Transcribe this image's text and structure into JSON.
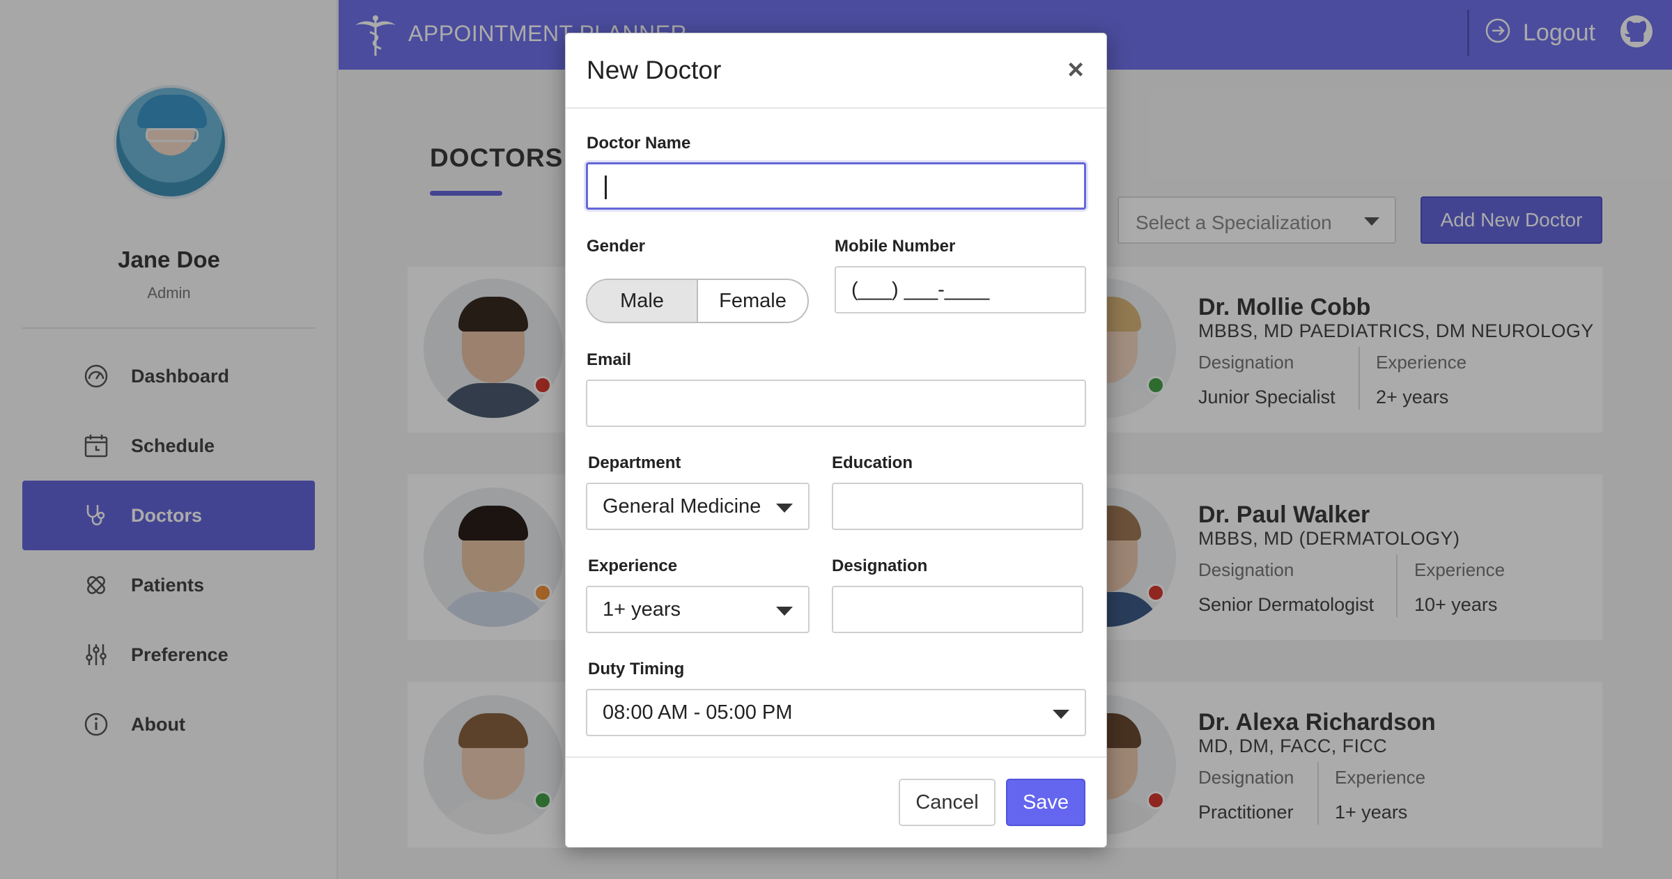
{
  "app": {
    "title": "APPOINTMENT PLANNER",
    "logout_label": "Logout"
  },
  "user": {
    "name": "Jane Doe",
    "role": "Admin"
  },
  "sidebar": {
    "items": [
      {
        "label": "Dashboard",
        "icon": "dashboard-gauge-icon"
      },
      {
        "label": "Schedule",
        "icon": "calendar-icon"
      },
      {
        "label": "Doctors",
        "icon": "stethoscope-icon",
        "active": true
      },
      {
        "label": "Patients",
        "icon": "bandage-icon"
      },
      {
        "label": "Preference",
        "icon": "sliders-icon"
      },
      {
        "label": "About",
        "icon": "info-icon"
      }
    ]
  },
  "main": {
    "title": "DOCTORS",
    "specialization_placeholder": "Select a Specialization",
    "add_button": "Add New Doctor",
    "doctors": [
      {
        "name": "Dr. Mollie Cobb",
        "education": "MBBS, MD PAEDIATRICS, DM NEUROLOGY",
        "designation_label": "Designation",
        "designation": "Junior Specialist",
        "experience_label": "Experience",
        "experience": "2+ years"
      },
      {
        "name": "Dr. Paul Walker",
        "education": "MBBS, MD (DERMATOLOGY)",
        "designation_label": "Designation",
        "designation": "Senior Dermatologist",
        "experience_label": "Experience",
        "experience": "10+ years"
      },
      {
        "name": "Dr. Alexa Richardson",
        "education": "MD, DM, FACC, FICC",
        "designation_label": "Designation",
        "designation": "Practitioner",
        "experience_label": "Experience",
        "experience": "1+ years"
      }
    ]
  },
  "modal": {
    "title": "New Doctor",
    "close": "×",
    "fields": {
      "doctor_name_label": "Doctor Name",
      "doctor_name_value": "",
      "gender_label": "Gender",
      "gender_options": [
        "Male",
        "Female"
      ],
      "gender_selected": "Male",
      "mobile_label": "Mobile Number",
      "mobile_placeholder": "(___) ___-____",
      "email_label": "Email",
      "department_label": "Department",
      "department_value": "General Medicine",
      "education_label": "Education",
      "experience_label": "Experience",
      "experience_value": "1+ years",
      "designation_label": "Designation",
      "duty_label": "Duty Timing",
      "duty_value": "08:00 AM - 05:00 PM"
    },
    "cancel_label": "Cancel",
    "save_label": "Save"
  },
  "colors": {
    "accent": "#6466d8",
    "header": "#7072ea",
    "status_red": "#d63a31",
    "status_orange": "#f0923b",
    "status_green": "#43a047"
  }
}
